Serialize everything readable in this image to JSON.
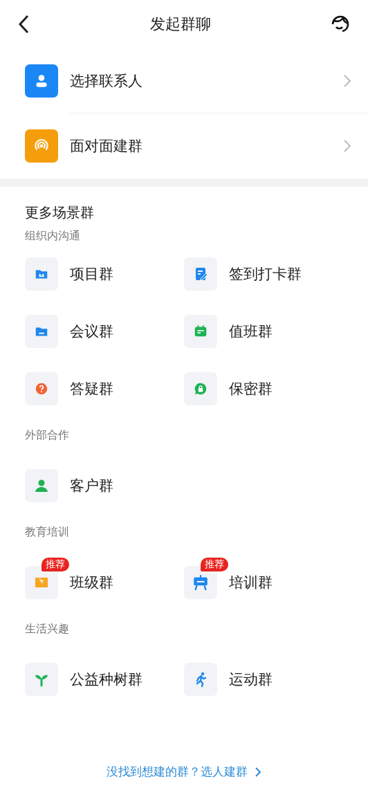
{
  "header": {
    "title": "发起群聊"
  },
  "actions": [
    {
      "label": "选择联系人"
    },
    {
      "label": "面对面建群"
    }
  ],
  "more": {
    "title": "更多场景群",
    "groups": [
      {
        "label": "组织内沟通",
        "items": [
          {
            "label": "项目群"
          },
          {
            "label": "签到打卡群"
          },
          {
            "label": "会议群"
          },
          {
            "label": "值班群"
          },
          {
            "label": "答疑群"
          },
          {
            "label": "保密群"
          }
        ]
      },
      {
        "label": "外部合作",
        "items": [
          {
            "label": "客户群"
          }
        ]
      },
      {
        "label": "教育培训",
        "items": [
          {
            "label": "班级群",
            "badge": "推荐"
          },
          {
            "label": "培训群",
            "badge": "推荐"
          }
        ]
      },
      {
        "label": "生活兴趣",
        "items": [
          {
            "label": "公益种树群"
          },
          {
            "label": "运动群"
          }
        ]
      }
    ]
  },
  "footer": {
    "link": "没找到想建的群？选人建群"
  }
}
